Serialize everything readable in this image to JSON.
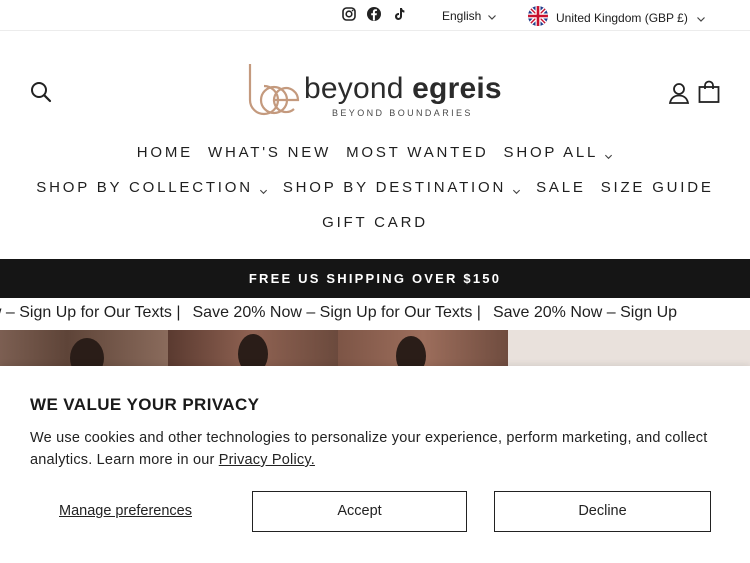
{
  "utility": {
    "language": "English",
    "region": "United Kingdom (GBP £)",
    "social_icons": [
      "instagram-icon",
      "facebook-icon",
      "tiktok-icon"
    ]
  },
  "brand": {
    "name_light": "beyond ",
    "name_bold": "egreis",
    "tagline": "BEYOND BOUNDARIES",
    "accent_color": "#c49a7e"
  },
  "nav": {
    "row1": [
      {
        "label": "HOME"
      },
      {
        "label": "WHAT'S NEW"
      },
      {
        "label": "MOST WANTED"
      },
      {
        "label": "SHOP ALL"
      }
    ],
    "row2": [
      {
        "label": "SHOP BY COLLECTION"
      },
      {
        "label": "SHOP BY DESTINATION"
      },
      {
        "label": "SALE"
      },
      {
        "label": "SIZE GUIDE"
      }
    ],
    "row3": [
      {
        "label": "GIFT CARD"
      }
    ]
  },
  "announcement": "FREE US SHIPPING OVER $150",
  "marquee": {
    "items": [
      "ow – Sign Up for Our Texts |",
      "Save 20% Now – Sign Up for Our Texts |",
      "Save 20% Now – Sign Up"
    ]
  },
  "cookie": {
    "title": "WE VALUE YOUR PRIVACY",
    "body": "We use cookies and other technologies to personalize your experience, perform marketing, and collect analytics. Learn more in our ",
    "policy_link": "Privacy Policy.",
    "manage": "Manage preferences",
    "accept": "Accept",
    "decline": "Decline"
  }
}
